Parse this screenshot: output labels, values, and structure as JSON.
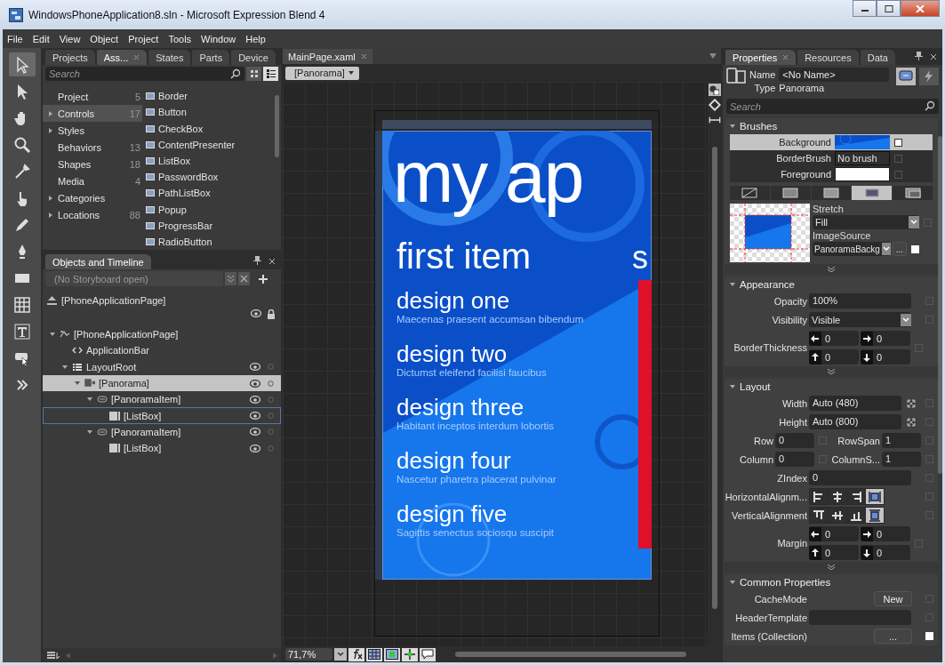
{
  "window": {
    "title": "WindowsPhoneApplication8.sln - Microsoft Expression Blend 4"
  },
  "menu": [
    "File",
    "Edit",
    "View",
    "Object",
    "Project",
    "Tools",
    "Window",
    "Help"
  ],
  "left_panel": {
    "tabs": [
      {
        "label": "Projects",
        "selected": false
      },
      {
        "label": "Ass...",
        "selected": true
      },
      {
        "label": "States",
        "selected": false
      },
      {
        "label": "Parts",
        "selected": false
      },
      {
        "label": "Device",
        "selected": false
      }
    ],
    "search": {
      "placeholder": "Search"
    },
    "categories": [
      {
        "label": "Project",
        "count": "5",
        "selected": false
      },
      {
        "label": "Controls",
        "count": "17",
        "expanded": false,
        "selected": true
      },
      {
        "label": "Styles",
        "expanded": false,
        "selected": false
      },
      {
        "label": "Behaviors",
        "count": "13",
        "selected": false
      },
      {
        "label": "Shapes",
        "count": "18",
        "selected": false
      },
      {
        "label": "Media",
        "count": "4",
        "selected": false
      },
      {
        "label": "Categories",
        "expanded": false,
        "selected": false
      },
      {
        "label": "Locations",
        "count": "88",
        "expanded": false,
        "selected": false
      }
    ],
    "assets": [
      "Border",
      "Button",
      "CheckBox",
      "ContentPresenter",
      "ListBox",
      "PasswordBox",
      "PathListBox",
      "Popup",
      "ProgressBar",
      "RadioButton"
    ]
  },
  "objects": {
    "title": "Objects and Timeline",
    "storyboard": {
      "placeholder": "(No Storyboard open)"
    },
    "scope": {
      "label": "[PhoneApplicationPage]"
    },
    "tree": [
      {
        "label": "[PhoneApplicationPage]",
        "kind": "page",
        "expanded": true,
        "selected": false,
        "children": [
          {
            "label": "ApplicationBar",
            "kind": "bar",
            "selected": false
          },
          {
            "label": "LayoutRoot",
            "kind": "grid",
            "expanded": true,
            "selected": false,
            "children": [
              {
                "label": "[Panorama]",
                "kind": "panorama",
                "expanded": true,
                "selected": true,
                "children": [
                  {
                    "label": "[PanoramaItem]",
                    "kind": "item",
                    "expanded": true,
                    "selected": false,
                    "children": [
                      {
                        "label": "[ListBox]",
                        "kind": "listbox",
                        "selected": false,
                        "focused": true
                      }
                    ]
                  },
                  {
                    "label": "[PanoramaItem]",
                    "kind": "item",
                    "expanded": true,
                    "selected": false,
                    "children": [
                      {
                        "label": "[ListBox]",
                        "kind": "listbox",
                        "selected": false,
                        "focused": false
                      }
                    ]
                  }
                ]
              }
            ]
          }
        ]
      }
    ]
  },
  "document": {
    "tab": "MainPage.xaml",
    "breadcrumb": "[Panorama]",
    "zoom": "71,7%",
    "phone": {
      "title": "my ap",
      "header": "first item",
      "next_header": "s",
      "items": [
        {
          "title": "design one",
          "subtitle": "Maecenas praesent accumsan bibendum"
        },
        {
          "title": "design two",
          "subtitle": "Dictumst eleifend facilisi faucibus"
        },
        {
          "title": "design three",
          "subtitle": "Habitant inceptos interdum lobortis"
        },
        {
          "title": "design four",
          "subtitle": "Nascetur pharetra placerat pulvinar"
        },
        {
          "title": "design five",
          "subtitle": "Sagittis senectus sociosqu suscipit"
        }
      ]
    }
  },
  "properties": {
    "tabs": [
      {
        "label": "Properties",
        "selected": true
      },
      {
        "label": "Resources",
        "selected": false
      },
      {
        "label": "Data",
        "selected": false
      }
    ],
    "name": {
      "label": "Name",
      "value": "<No Name>"
    },
    "type": {
      "label": "Type",
      "value": "Panorama"
    },
    "search": {
      "placeholder": "Search"
    },
    "brushes": {
      "title": "Brushes",
      "expanded": true,
      "rows": [
        {
          "label": "Background",
          "kind": "image",
          "selected": true
        },
        {
          "label": "BorderBrush",
          "kind": "text",
          "value": "No brush",
          "selected": false
        },
        {
          "label": "Foreground",
          "kind": "swatch",
          "color": "#ffffff",
          "selected": false
        }
      ],
      "brush_types": [
        {
          "selected": false
        },
        {
          "selected": false
        },
        {
          "selected": false
        },
        {
          "selected": true
        },
        {
          "selected": false
        }
      ],
      "stretch": {
        "label": "Stretch",
        "value": "Fill"
      },
      "image_source": {
        "label": "ImageSource",
        "value": "PanoramaBackg",
        "button": "..."
      }
    },
    "sections": [
      {
        "title": "Appearance",
        "expanded": true,
        "rows": [
          {
            "kind": "field",
            "label": "Opacity",
            "value": "100%"
          },
          {
            "kind": "dropdown",
            "label": "Visibility",
            "value": "Visible"
          },
          {
            "kind": "thickness",
            "label": "BorderThickness",
            "values": [
              "0",
              "0",
              "0",
              "0"
            ]
          }
        ]
      },
      {
        "title": "Layout",
        "expanded": true,
        "rows": [
          {
            "kind": "size",
            "label": "Width",
            "value": "Auto (480)"
          },
          {
            "kind": "size",
            "label": "Height",
            "value": "Auto (800)"
          },
          {
            "kind": "twin",
            "items": [
              {
                "label": "Row",
                "value": "0"
              },
              {
                "label": "RowSpan",
                "value": "1"
              }
            ]
          },
          {
            "kind": "twin",
            "items": [
              {
                "label": "Column",
                "value": "0"
              },
              {
                "label": "ColumnS...",
                "value": "1"
              }
            ]
          },
          {
            "kind": "field",
            "label": "ZIndex",
            "value": "0"
          },
          {
            "kind": "halign",
            "label": "HorizontalAlignm...",
            "options": [
              {
                "selected": false
              },
              {
                "selected": false
              },
              {
                "selected": false
              },
              {
                "selected": true
              }
            ]
          },
          {
            "kind": "valign",
            "label": "VerticalAlignment",
            "options": [
              {
                "selected": false
              },
              {
                "selected": false
              },
              {
                "selected": false
              },
              {
                "selected": true
              }
            ]
          },
          {
            "kind": "thickness",
            "label": "Margin",
            "values": [
              "0",
              "0",
              "0",
              "0"
            ]
          }
        ]
      },
      {
        "title": "Common Properties",
        "expanded": true,
        "rows": [
          {
            "kind": "button",
            "label": "CacheMode",
            "value": "New"
          },
          {
            "kind": "field",
            "label": "HeaderTemplate"
          },
          {
            "kind": "button",
            "label": "Items (Collection)",
            "value": "..."
          }
        ]
      }
    ]
  }
}
